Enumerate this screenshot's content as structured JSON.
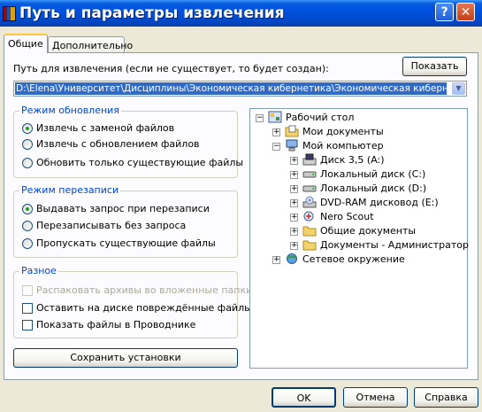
{
  "window": {
    "title": "Путь и параметры извлечения",
    "help_glyph": "?",
    "close_glyph": "✕"
  },
  "tabs": [
    {
      "label": "Общие",
      "active": true
    },
    {
      "label": "Дополнительно",
      "active": false
    }
  ],
  "path": {
    "label": "Путь для извлечения (если не существует, то будет создан):",
    "value": "D:\\Elena\\Университет\\Дисциплины\\Экономическая кибернетика\\Экономическая кибернетика",
    "show_button": "Показать",
    "dropdown_glyph": "▼"
  },
  "update_mode": {
    "title": "Режим обновления",
    "options": [
      {
        "label": "Извлечь с заменой файлов",
        "checked": true
      },
      {
        "label": "Извлечь с обновлением файлов",
        "checked": false
      },
      {
        "label": "Обновить только существующие файлы",
        "checked": false
      }
    ]
  },
  "overwrite_mode": {
    "title": "Режим перезаписи",
    "options": [
      {
        "label": "Выдавать запрос при перезаписи",
        "checked": true
      },
      {
        "label": "Перезаписывать без запроса",
        "checked": false
      },
      {
        "label": "Пропускать существующие файлы",
        "checked": false
      }
    ]
  },
  "misc": {
    "title": "Разное",
    "options": [
      {
        "label": "Распаковать архивы во вложенные папки",
        "checked": false,
        "disabled": true
      },
      {
        "label": "Оставить на диске повреждённые файлы",
        "checked": false,
        "disabled": false
      },
      {
        "label": "Показать файлы в Проводнике",
        "checked": false,
        "disabled": false
      }
    ]
  },
  "save_button": "Сохранить установки",
  "tree": {
    "items": [
      {
        "label": "Рабочий стол",
        "icon": "desktop-icon",
        "expander": "−"
      },
      {
        "label": "Мои документы",
        "icon": "my-documents-icon",
        "expander": "+"
      },
      {
        "label": "Мой компьютер",
        "icon": "my-computer-icon",
        "expander": "−"
      },
      {
        "label": "Диск 3,5 (A:)",
        "icon": "floppy-drive-icon",
        "expander": "+"
      },
      {
        "label": "Локальный диск (C:)",
        "icon": "hard-drive-icon",
        "expander": "+"
      },
      {
        "label": "Локальный диск (D:)",
        "icon": "hard-drive-icon",
        "expander": "+"
      },
      {
        "label": "DVD-RAM дисковод (E:)",
        "icon": "dvd-drive-icon",
        "expander": "+"
      },
      {
        "label": "Nero Scout",
        "icon": "nero-scout-icon",
        "expander": "+"
      },
      {
        "label": "Общие документы",
        "icon": "folder-icon",
        "expander": "+"
      },
      {
        "label": "Документы - Администратор",
        "icon": "folder-icon",
        "expander": "+"
      },
      {
        "label": "Сетевое окружение",
        "icon": "network-icon",
        "expander": "+"
      }
    ]
  },
  "buttons": {
    "ok": "OK",
    "cancel": "Отмена",
    "help": "Справка"
  }
}
